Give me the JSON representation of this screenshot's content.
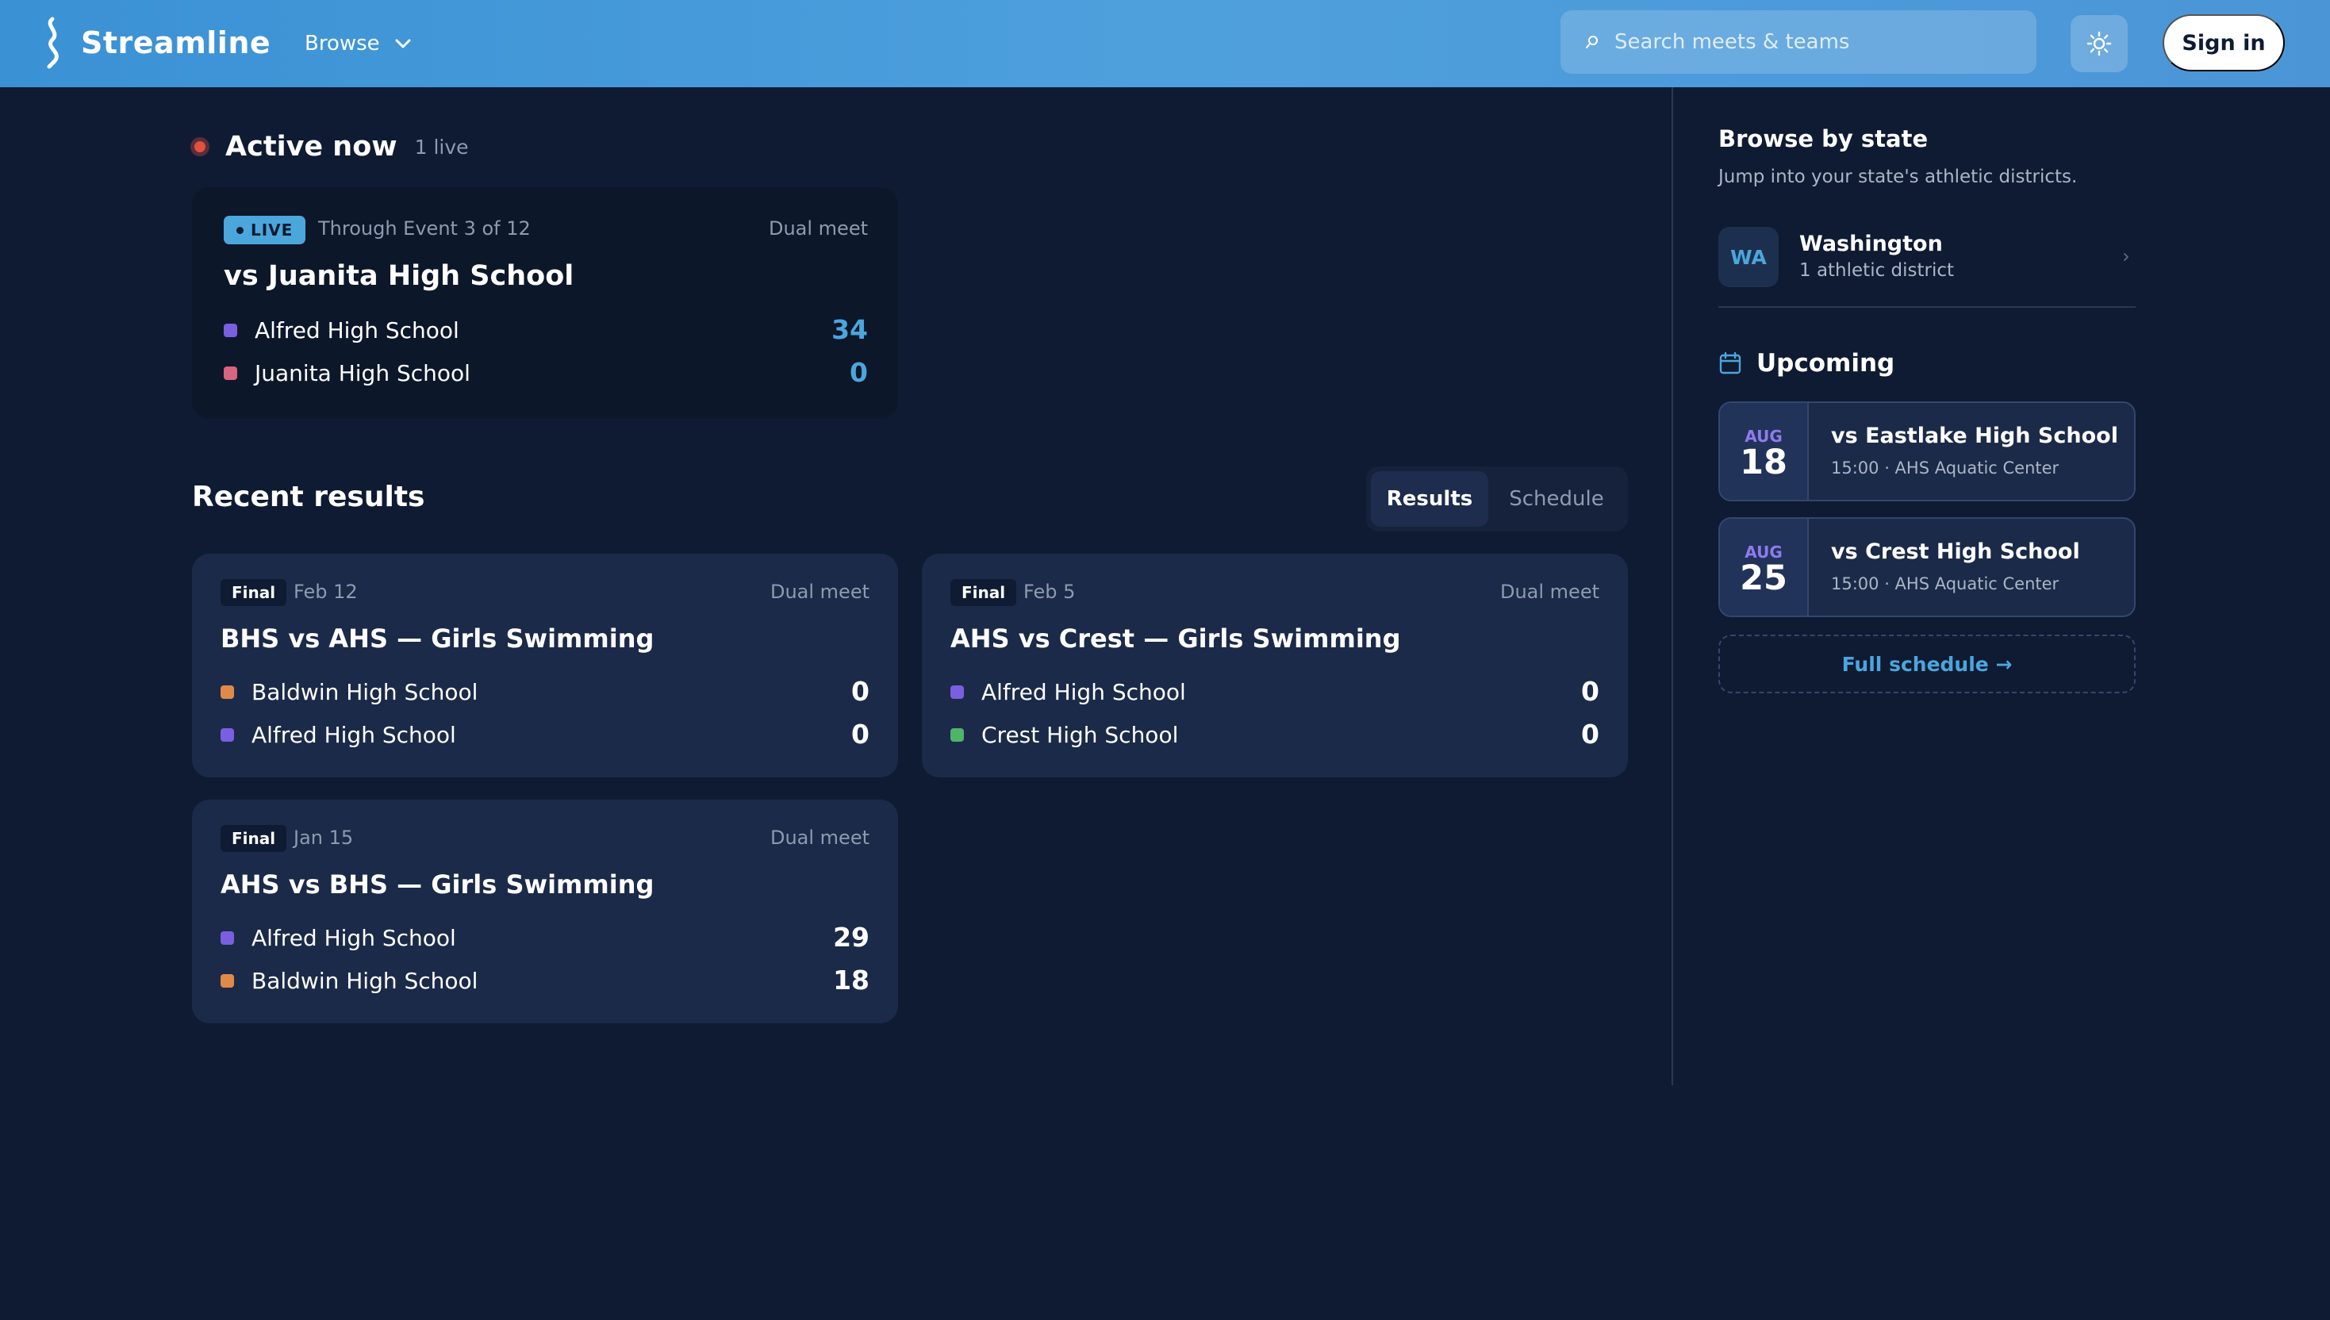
{
  "header": {
    "brand_name": "Streamline",
    "browse_label": "Browse",
    "search_placeholder": "Search meets & teams",
    "sign_in_label": "Sign in"
  },
  "active": {
    "title": "Active now",
    "count_label": "1 live",
    "card": {
      "badge": "LIVE",
      "progress": "Through Event 3 of 12",
      "meet_type": "Dual meet",
      "title": "vs Juanita High School",
      "teams": [
        {
          "name": "Alfred High School",
          "score": "34",
          "color": "#7a5fe0"
        },
        {
          "name": "Juanita High School",
          "score": "0",
          "color": "#d9647e"
        }
      ]
    }
  },
  "recent": {
    "title": "Recent results",
    "tabs": [
      {
        "label": "Results",
        "active": true
      },
      {
        "label": "Schedule",
        "active": false
      }
    ],
    "cards": [
      {
        "status": "Final",
        "date": "Feb 12",
        "meet_type": "Dual meet",
        "title": "BHS vs AHS — Girls Swimming",
        "teams": [
          {
            "name": "Baldwin High School",
            "score": "0",
            "color": "#e08a4a"
          },
          {
            "name": "Alfred High School",
            "score": "0",
            "color": "#7a5fe0"
          }
        ]
      },
      {
        "status": "Final",
        "date": "Feb 5",
        "meet_type": "Dual meet",
        "title": "AHS vs Crest — Girls Swimming",
        "teams": [
          {
            "name": "Alfred High School",
            "score": "0",
            "color": "#7a5fe0"
          },
          {
            "name": "Crest High School",
            "score": "0",
            "color": "#4fb36a"
          }
        ]
      },
      {
        "status": "Final",
        "date": "Jan 15",
        "meet_type": "Dual meet",
        "title": "AHS vs BHS — Girls Swimming",
        "teams": [
          {
            "name": "Alfred High School",
            "score": "29",
            "color": "#7a5fe0"
          },
          {
            "name": "Baldwin High School",
            "score": "18",
            "color": "#e08a4a"
          }
        ]
      }
    ]
  },
  "sidebar": {
    "browse_title": "Browse by state",
    "browse_subtitle": "Jump into your state's athletic districts.",
    "states": [
      {
        "abbr": "WA",
        "name": "Washington",
        "count": "1 athletic district"
      }
    ],
    "upcoming_title": "Upcoming",
    "upcoming": [
      {
        "month": "AUG",
        "day": "18",
        "title": "vs Eastlake High School",
        "subtitle": "15:00 · AHS Aquatic Center"
      },
      {
        "month": "AUG",
        "day": "25",
        "title": "vs Crest High School",
        "subtitle": "15:00 · AHS Aquatic Center"
      }
    ],
    "full_schedule_label": "Full schedule →"
  },
  "colors": {
    "accent": "#4ba6dc",
    "background": "#0f1b32",
    "live_red": "#e2503e"
  },
  "icons": [
    "streamline-logo-icon",
    "chevron-down-icon",
    "search-icon",
    "sun-icon",
    "live-dot-icon",
    "chevron-right-icon",
    "calendar-icon"
  ]
}
